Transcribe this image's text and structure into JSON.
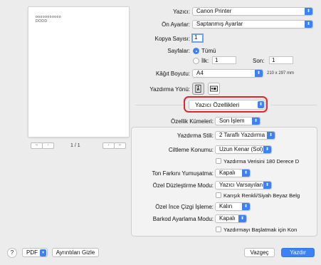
{
  "preview": {
    "page_text": "ooooooooooo\nDDDD",
    "page_indicator": "1 / 1"
  },
  "printer": {
    "label": "Yazıcı:",
    "value": "Canon Printer"
  },
  "presets": {
    "label": "Ön Ayarlar:",
    "value": "Saptanmış Ayarlar"
  },
  "copies": {
    "label": "Kopya Sayısı:",
    "value": "1"
  },
  "pages": {
    "label": "Sayfalar:",
    "all_label": "Tümü",
    "from_label": "İlk:",
    "from_value": "1",
    "to_label": "Son:",
    "to_value": "1"
  },
  "paper_size": {
    "label": "Kâğıt Boyutu:",
    "value": "A4",
    "dimensions": "210 x 297 mm"
  },
  "orientation": {
    "label": "Yazdırma Yönü:"
  },
  "section": {
    "value": "Yazıcı Özellikleri"
  },
  "feature_set": {
    "label": "Özellik Kümeleri:",
    "value": "Son İşlem"
  },
  "options": {
    "print_style": {
      "label": "Yazdırma Stili:",
      "value": "2 Taraflı Yazdırma"
    },
    "binding": {
      "label": "Ciltleme Konumu:",
      "value": "Uzun Kenar (Sol)"
    },
    "rotate_180": {
      "label": "Yazdırma Verisini 180 Derece D"
    },
    "tone_smoothing": {
      "label": "Ton Farkını Yumuşatma:",
      "value": "Kapalı"
    },
    "special_correction": {
      "label": "Özel Düzleştirme Modu:",
      "value": "Yazıcı Varsayılanı"
    },
    "mixed_color": {
      "label": "Karışık Renkli/Siyah Beyaz Belg"
    },
    "thin_line": {
      "label": "Özel İnce Çizgi İşleme:",
      "value": "Kalın"
    },
    "barcode": {
      "label": "Barkod Ayarlama Modu:",
      "value": "Kapalı"
    },
    "delay_print": {
      "label": "Yazdırmayı Başlatmak için Kon"
    }
  },
  "footer": {
    "help": "?",
    "pdf_label": "PDF",
    "hide_details": "Ayrıntıları Gizle",
    "cancel": "Vazgeç",
    "print": "Yazdır"
  },
  "colors": {
    "accent": "#3c82f6",
    "highlight": "#e3262a"
  }
}
